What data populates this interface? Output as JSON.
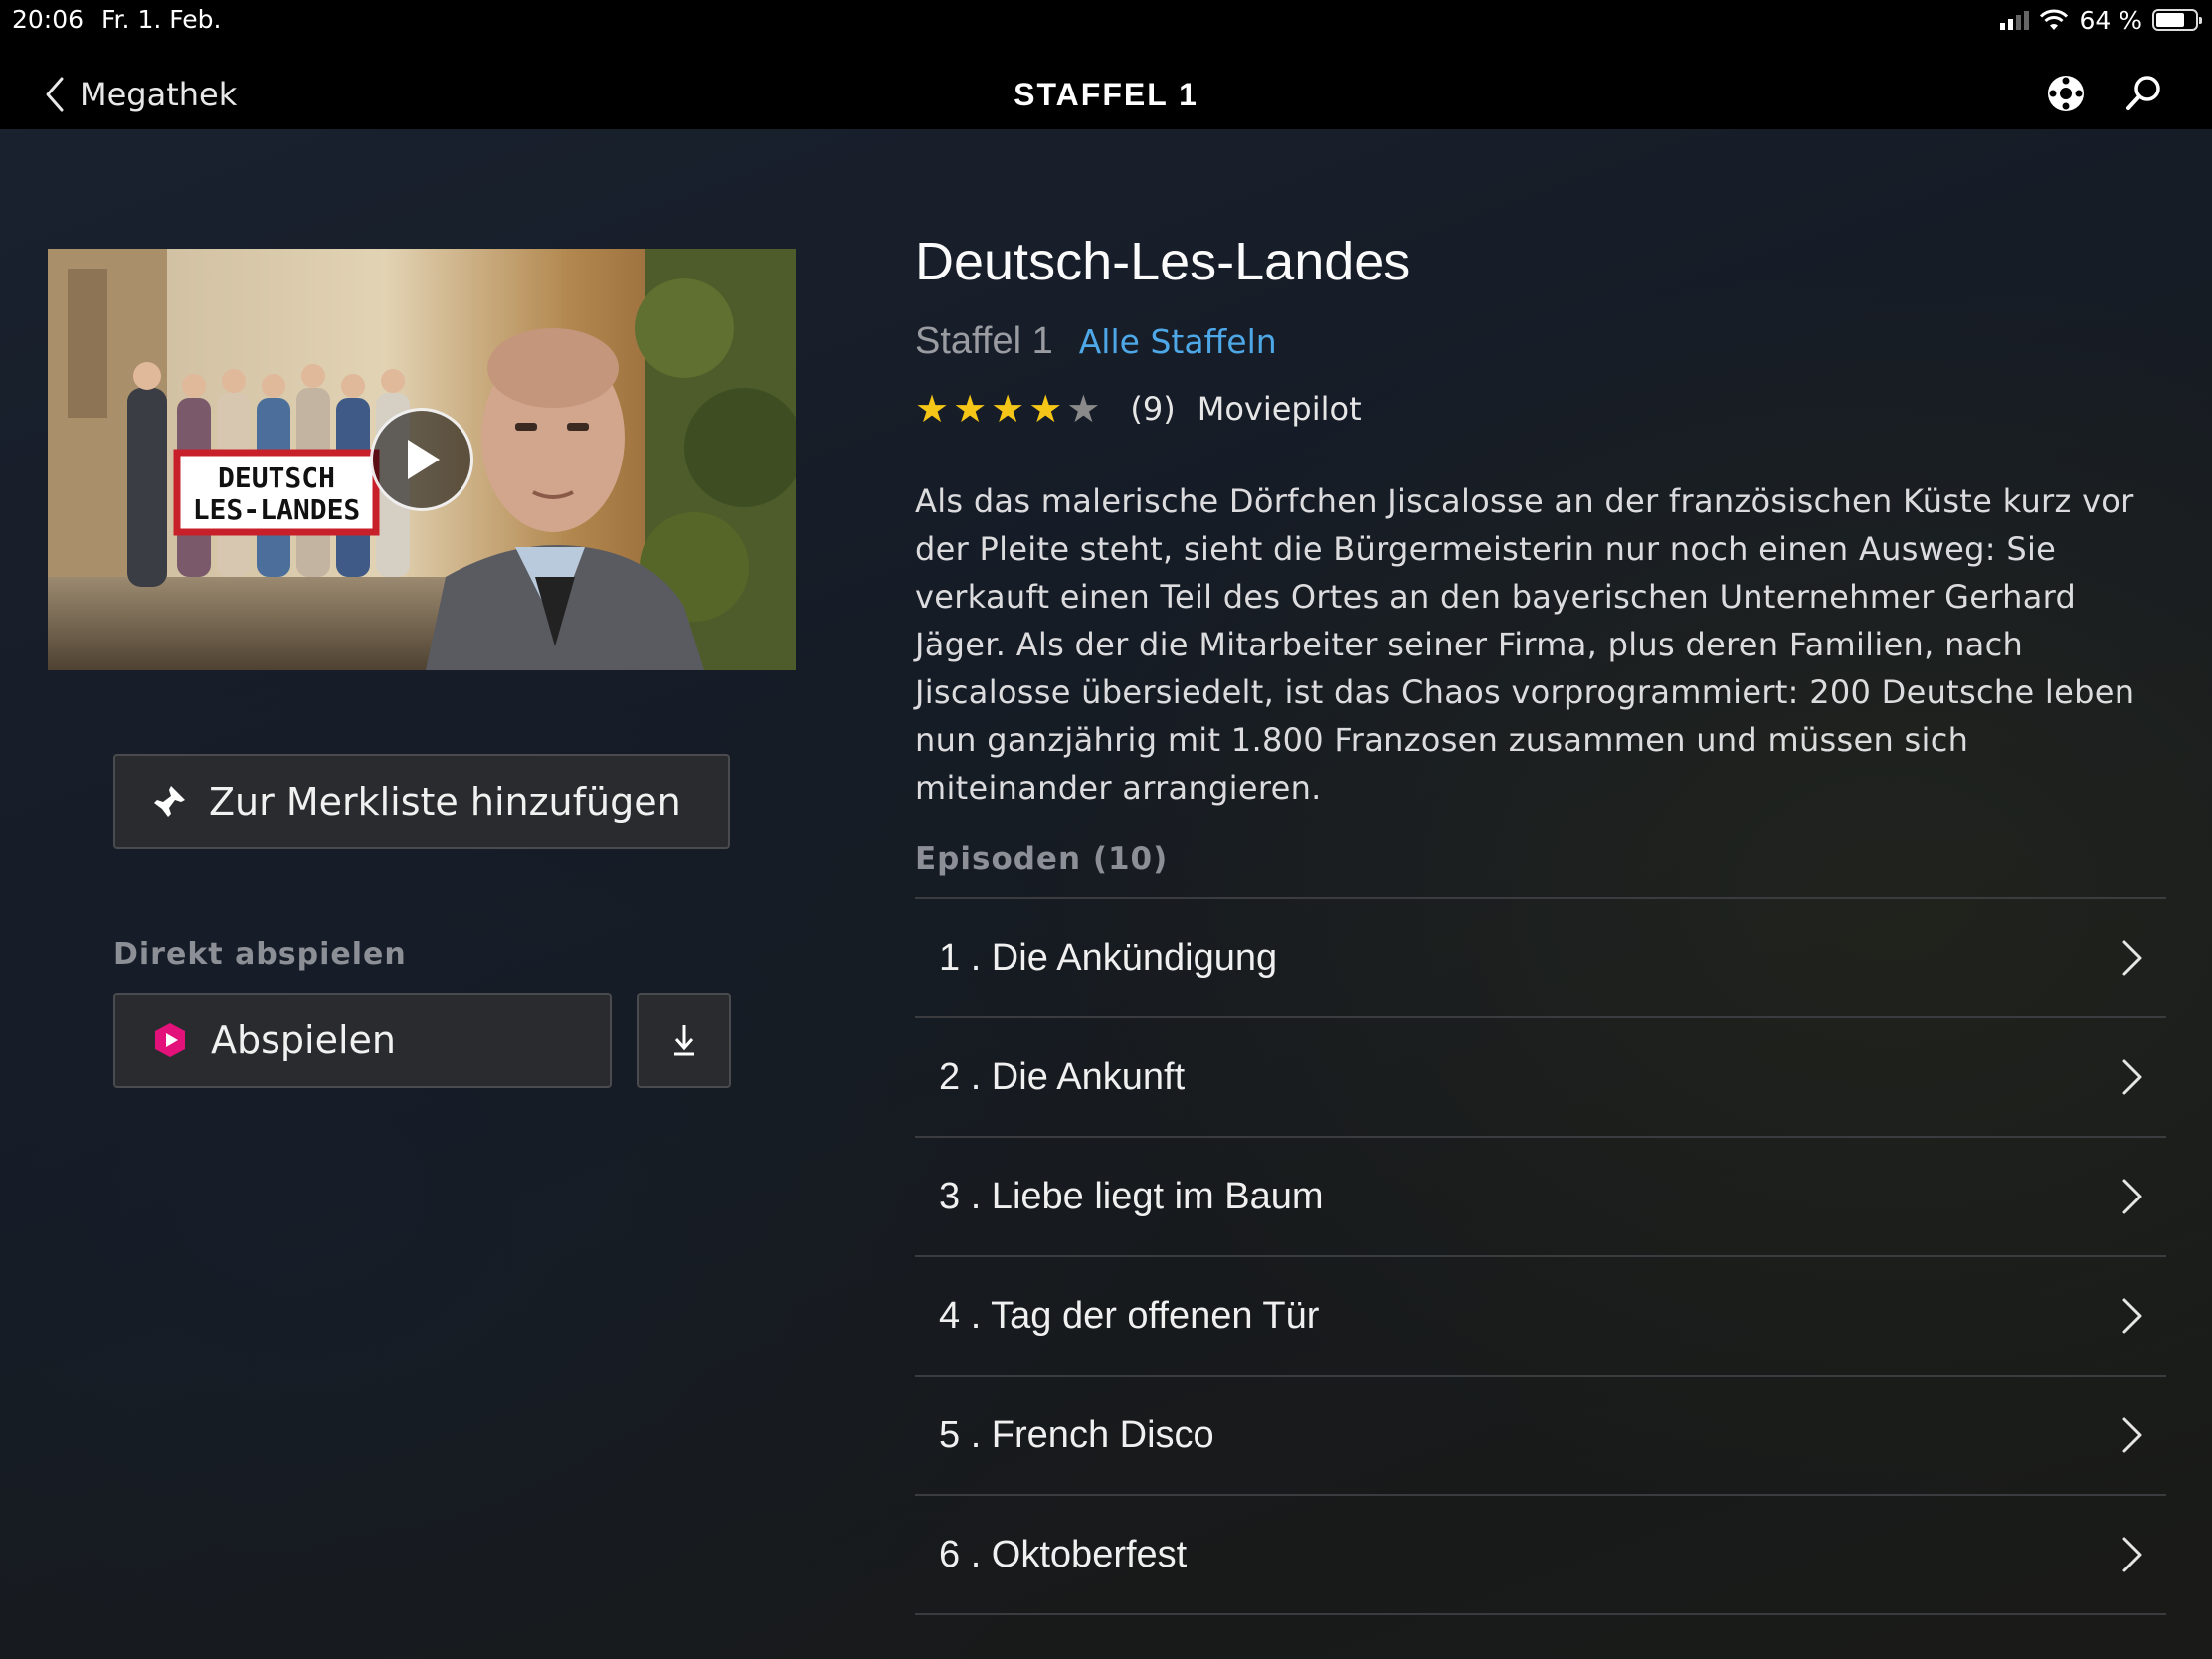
{
  "status_bar": {
    "time": "20:06",
    "date": "Fr. 1. Feb.",
    "battery": "64 %"
  },
  "nav": {
    "back_label": "Megathek",
    "title": "STAFFEL 1",
    "icons": [
      "cast-icon",
      "search-icon"
    ]
  },
  "poster": {
    "sign_line1": "DEUTSCH",
    "sign_line2": "LES-LANDES"
  },
  "actions": {
    "merkliste_label": "Zur Merkliste hinzufügen",
    "direkt_heading": "Direkt abspielen",
    "play_label": "Abspielen"
  },
  "show": {
    "title": "Deutsch-Les-Landes",
    "season": "Staffel 1",
    "all_seasons": "Alle Staffeln",
    "rating_stars": 4,
    "rating_max": 5,
    "rating_count": "(9)",
    "rating_source": "Moviepilot",
    "description": "Als das malerische Dörfchen Jiscalosse an der französischen Küste kurz vor der Pleite steht, sieht die Bürgermeisterin nur noch einen Ausweg: Sie verkauft einen Teil des Ortes an den bayerischen Unternehmer Gerhard Jäger. Als der die Mitarbeiter seiner Firma, plus deren Familien, nach Jiscalosse übersiedelt, ist das Chaos vorprogrammiert: 200 Deutsche leben nun ganzjährig mit 1.800 Franzosen zusammen und müssen sich miteinander arrangieren."
  },
  "episodes": {
    "heading": "Episoden (10)",
    "items": [
      "1 . Die Ankündigung",
      "2 . Die Ankunft",
      "3 . Liebe liegt im Baum",
      "4 . Tag der offenen Tür",
      "5 . French Disco",
      "6 . Oktoberfest"
    ]
  },
  "colors": {
    "accent_link": "#4ea8e8",
    "star_filled": "#f5c518",
    "star_empty": "#8a8a8a",
    "play_icon": "#e2127a"
  }
}
